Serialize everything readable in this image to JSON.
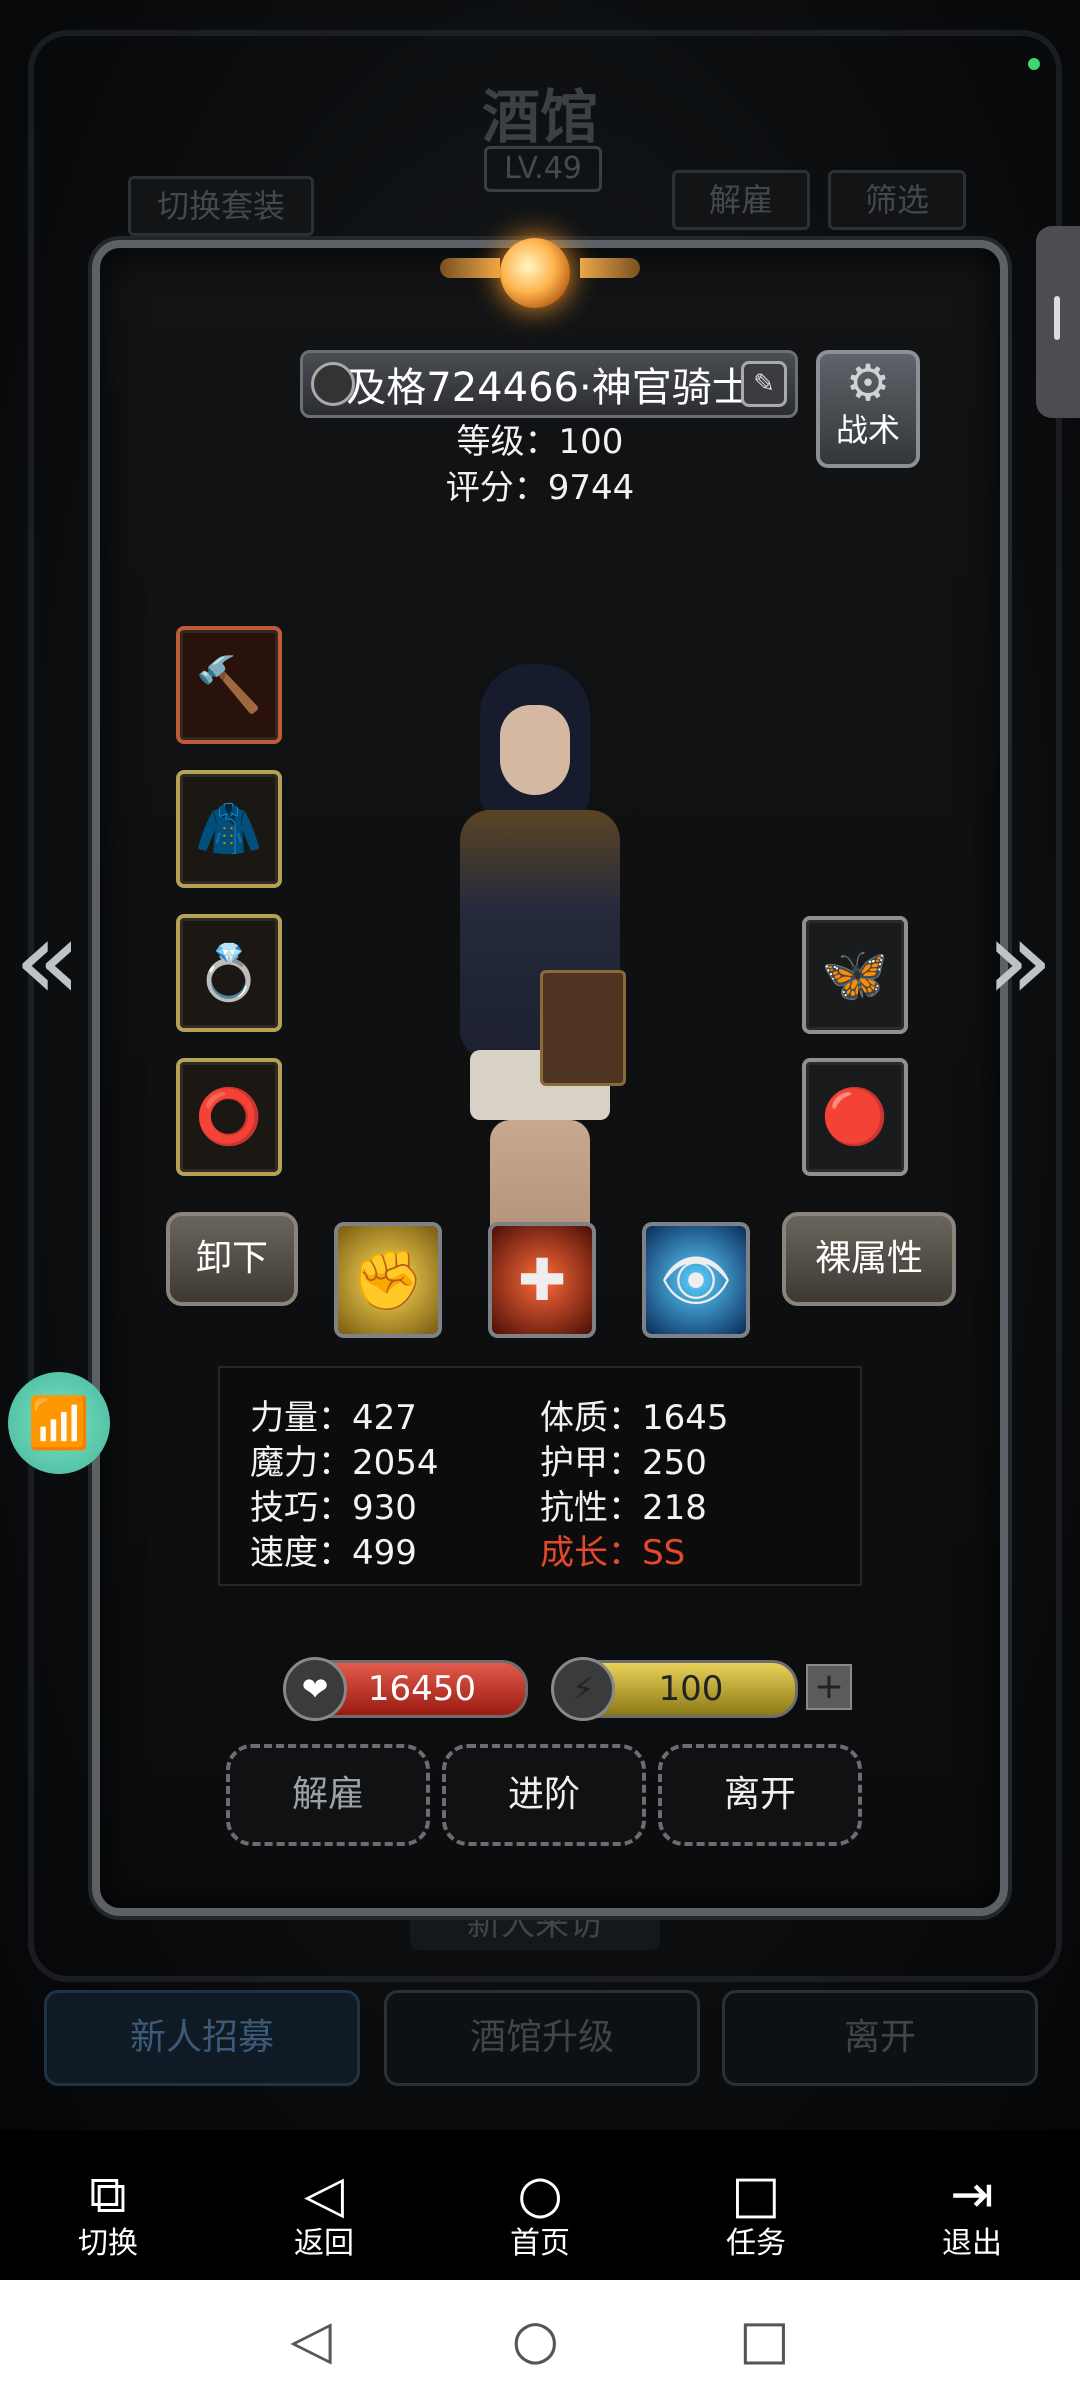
{
  "background": {
    "title": "酒馆",
    "level": "LV.49",
    "switch_outfit": "切换套装",
    "dismiss": "解雇",
    "filter": "筛选",
    "new_visitor": "新人来访",
    "bottom_buttons": [
      "新人招募",
      "酒馆升级",
      "离开"
    ]
  },
  "hero": {
    "name": "及格724466·神官骑士",
    "level_line": "等级：100",
    "score_line": "评分：9744",
    "tactic_label": "战术"
  },
  "actions": {
    "unequip": "卸下",
    "base_attr": "裸属性"
  },
  "stats": {
    "strength": "力量：427",
    "constitution": "体质：1645",
    "magic": "魔力：2054",
    "armor": "护甲：250",
    "skill": "技巧：930",
    "resistance": "抗性：218",
    "speed": "速度：499",
    "growth": "成长：SS"
  },
  "resources": {
    "hp": "16450",
    "energy": "100",
    "plus": "+"
  },
  "dialog_buttons": {
    "dismiss": "解雇",
    "advance": "进阶",
    "leave": "离开"
  },
  "toolbar": {
    "items": [
      {
        "label": "切换",
        "icon": "phone-switch-icon"
      },
      {
        "label": "返回",
        "icon": "back-triangle-icon"
      },
      {
        "label": "首页",
        "icon": "home-circle-icon"
      },
      {
        "label": "任务",
        "icon": "task-square-icon"
      },
      {
        "label": "退出",
        "icon": "exit-icon"
      }
    ]
  },
  "colors": {
    "growth": "#e5482d",
    "hp": "#c8332a",
    "energy": "#d6bf3e",
    "wifi": "#5ccaa9"
  }
}
